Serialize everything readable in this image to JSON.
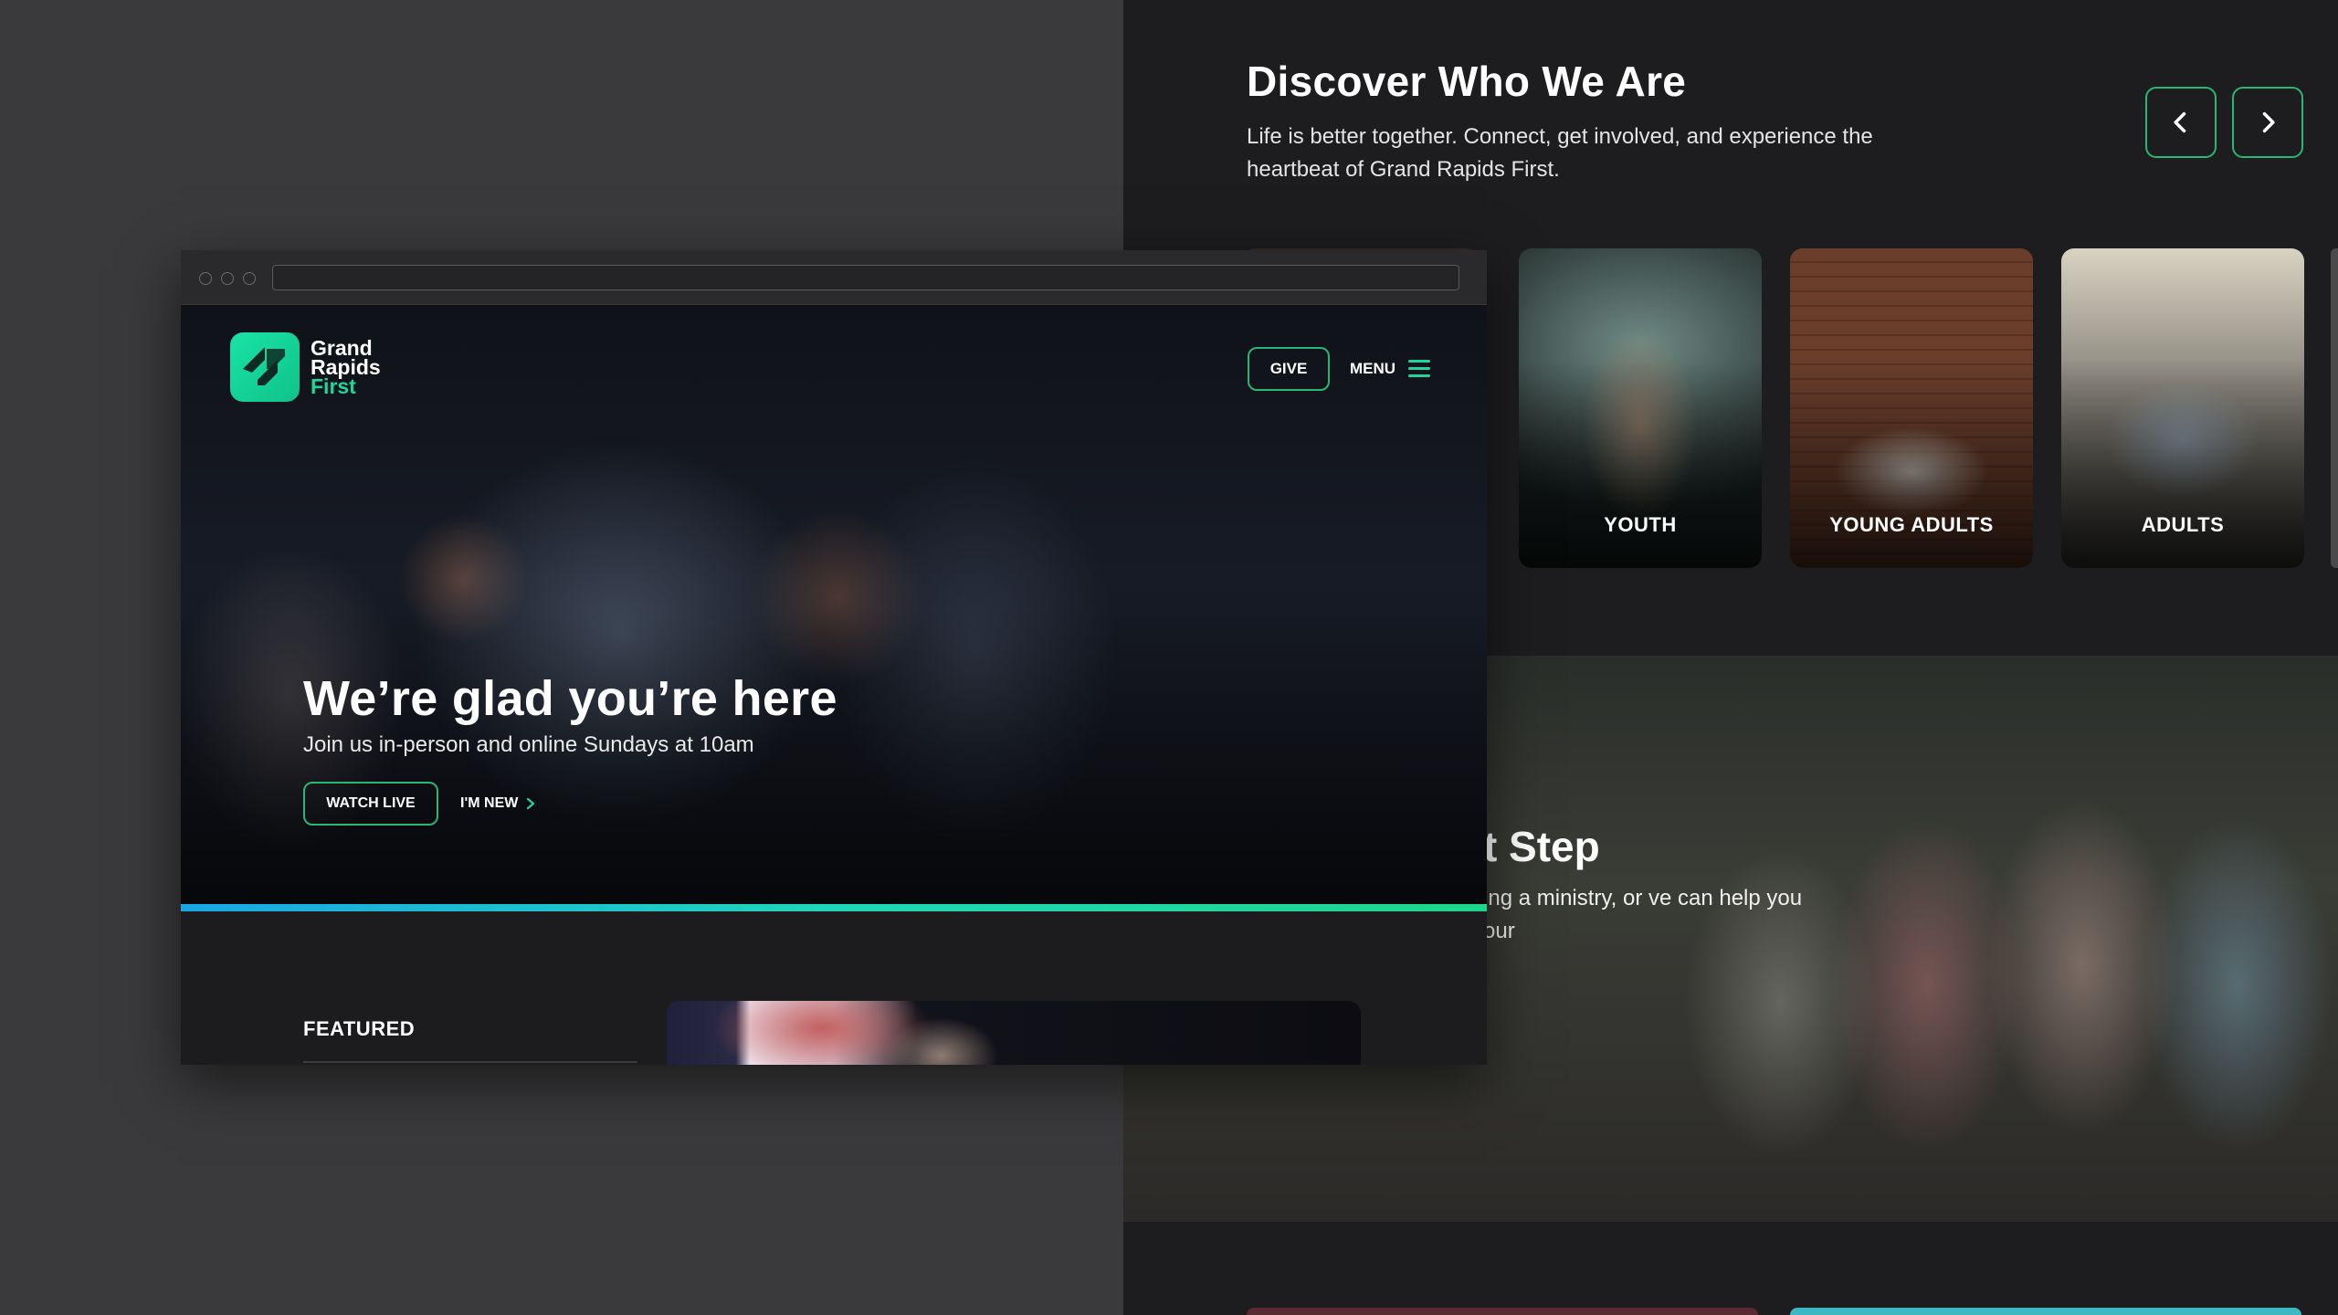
{
  "discover": {
    "title": "Discover Who We Are",
    "description": "Life is better together. Connect, get involved, and experience the heartbeat of Grand Rapids First.",
    "prev_icon": "chevron-left-icon",
    "next_icon": "chevron-right-icon"
  },
  "ministry_cards": [
    {
      "label": "YOUTH"
    },
    {
      "label": "YOUNG ADULTS"
    },
    {
      "label": "ADULTS"
    }
  ],
  "next_step": {
    "title_fragment": "lext Step",
    "description_fragment": "d, joining a ministry, or ve can help you take your"
  },
  "browser": {
    "logo": {
      "line1": "Grand",
      "line2": "Rapids",
      "line3": "First"
    },
    "give_label": "GIVE",
    "menu_label": "MENU",
    "hero": {
      "title": "We’re glad you’re here",
      "subtitle": "Join us in-person and online Sundays at 10am",
      "watch_live_label": "WATCH LIVE",
      "im_new_label": "I'M NEW"
    },
    "featured_label": "FEATURED"
  },
  "colors": {
    "accent_green": "#2bb673",
    "brand_mint": "#1fd69a",
    "bar_start": "#1aa7e6",
    "bar_end": "#1dd68a",
    "background": "#3a3a3c",
    "panel": "#1d1d1f"
  }
}
